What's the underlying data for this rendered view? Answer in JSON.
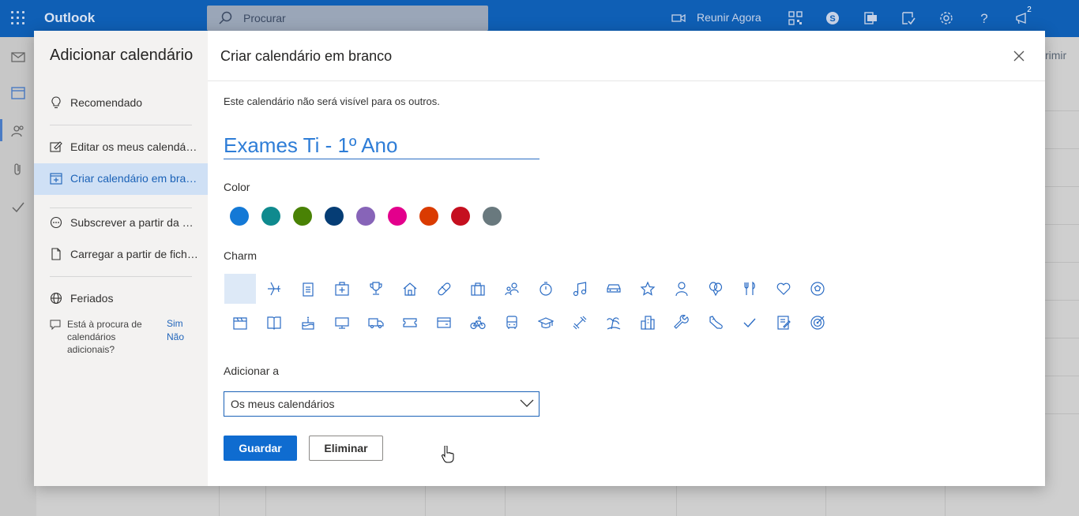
{
  "topbar": {
    "brand": "Outlook",
    "search_placeholder": "Procurar",
    "meet_now": "Reunir Agora",
    "notification_count": "2"
  },
  "background": {
    "partial_text": "rimir"
  },
  "sidebar": {
    "title": "Adicionar calendário",
    "items": [
      {
        "label": "Recomendado",
        "icon": "lightbulb-icon"
      },
      {
        "label": "Editar os meus calendários",
        "icon": "edit-calendar-icon"
      },
      {
        "label": "Criar calendário em branco",
        "icon": "add-calendar-icon",
        "selected": true
      },
      {
        "label": "Subscrever a partir da web",
        "icon": "subscribe-icon"
      },
      {
        "label": "Carregar a partir de ficheiro",
        "icon": "upload-file-icon"
      },
      {
        "label": "Feriados",
        "icon": "globe-icon"
      }
    ],
    "help_text": "Está à procura de calendários adicionais?",
    "help_yes": "Sim",
    "help_no": "Não"
  },
  "main": {
    "title": "Criar calendário em branco",
    "description": "Este calendário não será visível para os outros.",
    "calendar_name": "Exames Ti - 1º Ano",
    "color_label": "Color",
    "colors": [
      "#1479d6",
      "#0f8a8e",
      "#498205",
      "#053d75",
      "#8764b8",
      "#e3008c",
      "#da3b01",
      "#c50f1f",
      "#69797e"
    ],
    "charm_label": "Charm",
    "charms_row1": [
      "blank",
      "airplane-icon",
      "clipboard-icon",
      "medical-kit-icon",
      "trophy-icon",
      "home-icon",
      "pill-icon",
      "briefcase-icon",
      "people-icon",
      "stopwatch-icon",
      "music-note-icon",
      "car-icon",
      "star-icon",
      "person-icon",
      "balloon-icon",
      "fork-knife-icon",
      "heart-icon",
      "soccer-ball-icon"
    ],
    "charms_row2": [
      "clapperboard-icon",
      "book-icon",
      "cake-icon",
      "monitor-icon",
      "truck-icon",
      "ticket-icon",
      "credit-card-icon",
      "bicycle-icon",
      "bus-icon",
      "graduation-cap-icon",
      "dumbbell-icon",
      "palm-tree-icon",
      "building-icon",
      "wrench-icon",
      "sneaker-icon",
      "checkmark-icon",
      "notepad-icon",
      "target-icon"
    ],
    "add_to_label": "Adicionar a",
    "add_to_value": "Os meus calendários",
    "save_label": "Guardar",
    "discard_label": "Eliminar"
  }
}
